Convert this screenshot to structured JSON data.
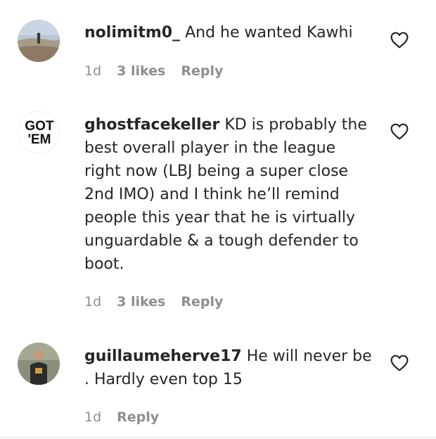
{
  "comments": [
    {
      "username": "nolimitm0_",
      "text": "And he wanted Kawhi",
      "time": "1d",
      "likes": "3 likes",
      "reply": "Reply"
    },
    {
      "username": "ghostfacekeller",
      "text": "KD is probably the best overall player in the league right now (LBJ being a super close 2nd IMO) and I think he’ll remind people this year that he is virtually unguardable & a tough defender to boot.",
      "avatar_text_line1": "GOT",
      "avatar_text_line2": "'EM",
      "time": "1d",
      "likes": "3 likes",
      "reply": "Reply"
    },
    {
      "username": "guillaumeherve17",
      "text": "He will never be . Hardly even top 15",
      "time": "1d",
      "reply": "Reply"
    }
  ],
  "colors": {
    "text": "#262626",
    "secondary": "#8e8e8e"
  }
}
